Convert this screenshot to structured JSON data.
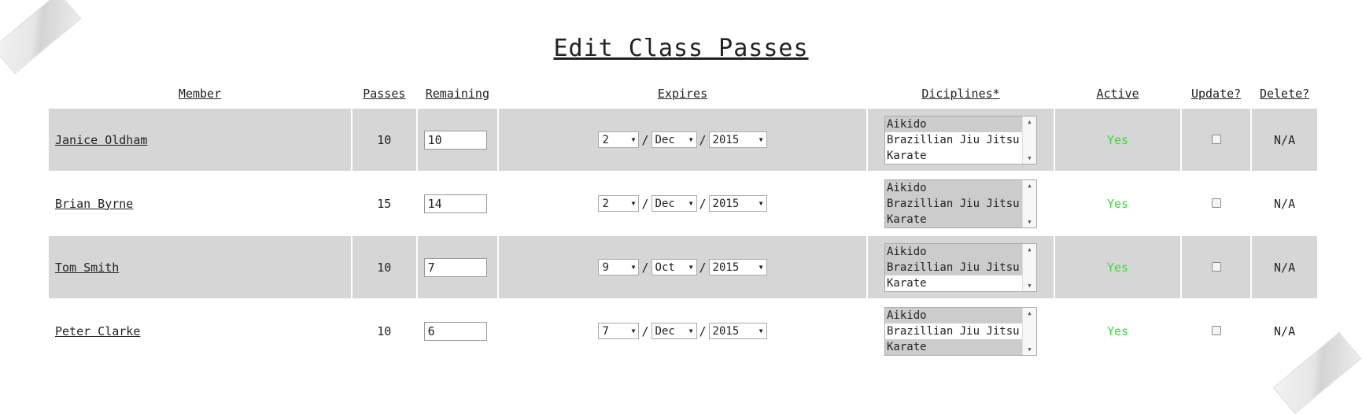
{
  "page": {
    "title": "Edit Class Passes"
  },
  "table": {
    "headers": {
      "member": "Member",
      "passes": "Passes",
      "remaining": "Remaining",
      "expires": "Expires",
      "disciplines": "Diciplines*",
      "active": "Active",
      "update": "Update?",
      "delete": "Delete?"
    },
    "disciplines_options": [
      "Aikido",
      "Brazillian Jiu Jitsu",
      "Karate"
    ],
    "rows": [
      {
        "member": "Janice Oldham",
        "passes": "10",
        "remaining": "10",
        "day": "2",
        "month": "Dec",
        "year": "2015",
        "active": "Yes",
        "delete": "N/A",
        "selected_disciplines": [
          "Aikido"
        ]
      },
      {
        "member": "Brian Byrne",
        "passes": "15",
        "remaining": "14",
        "day": "2",
        "month": "Dec",
        "year": "2015",
        "active": "Yes",
        "delete": "N/A",
        "selected_disciplines": [
          "Aikido",
          "Brazillian Jiu Jitsu",
          "Karate"
        ]
      },
      {
        "member": "Tom Smith",
        "passes": "10",
        "remaining": "7",
        "day": "9",
        "month": "Oct",
        "year": "2015",
        "active": "Yes",
        "delete": "N/A",
        "selected_disciplines": [
          "Aikido",
          "Brazillian Jiu Jitsu"
        ]
      },
      {
        "member": "Peter Clarke",
        "passes": "10",
        "remaining": "6",
        "day": "7",
        "month": "Dec",
        "year": "2015",
        "active": "Yes",
        "delete": "N/A",
        "selected_disciplines": [
          "Aikido",
          "Karate"
        ]
      }
    ],
    "separator": "/"
  },
  "colors": {
    "row_shade": "#d6d6d6",
    "active_text": "#33dd33",
    "selected_option": "#cccccc"
  }
}
